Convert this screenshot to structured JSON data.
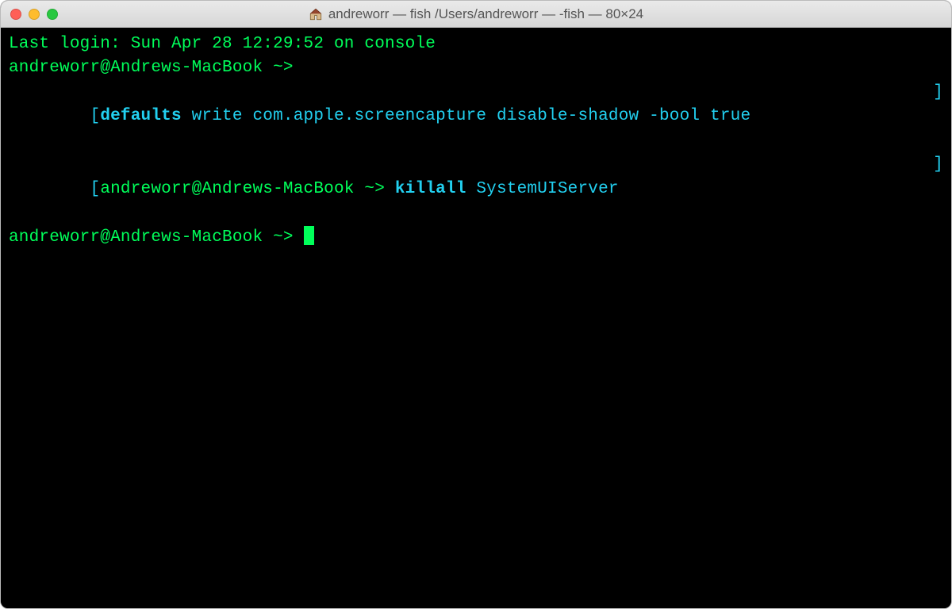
{
  "titlebar": {
    "title": "andreworr — fish  /Users/andreworr — -fish — 80×24"
  },
  "terminal": {
    "line1_last_login": "Last login: Sun Apr 28 12:29:52 on console",
    "line2_prompt": "andreworr@Andrews-MacBook ~>",
    "line3_bracket_l": "[",
    "line3_cmd": "defaults",
    "line3_args": " write com.apple.screencapture disable-shadow -bool true",
    "line3_bracket_r": "]",
    "line4_bracket_l": "[",
    "line4_prompt": "andreworr@Andrews-MacBook ~> ",
    "line4_cmd": "killall",
    "line4_args": " SystemUIServer",
    "line4_bracket_r": "]",
    "line5_prompt": "andreworr@Andrews-MacBook ~> "
  }
}
